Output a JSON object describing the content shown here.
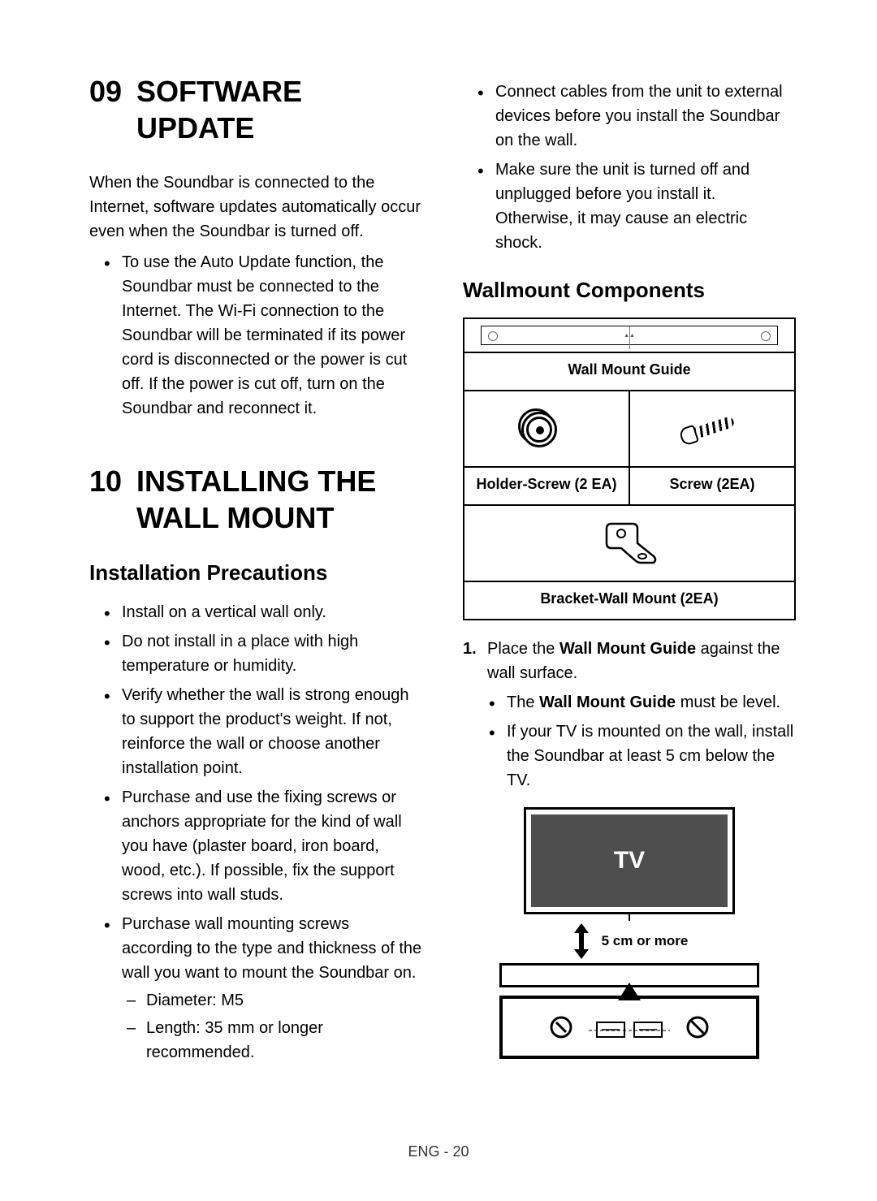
{
  "section09": {
    "number": "09",
    "title": "SOFTWARE UPDATE",
    "intro": "When the Soundbar is connected to the Internet, software updates automatically occur even when the Soundbar is turned off.",
    "bullets": [
      "To use the Auto Update function, the Soundbar must be connected to the Internet. The Wi-Fi connection to the Soundbar will be terminated if its power cord is disconnected or the power is cut off. If the power is cut off, turn on the Soundbar and reconnect it."
    ]
  },
  "section10": {
    "number": "10",
    "title": "INSTALLING THE WALL MOUNT",
    "precautions_heading": "Installation Precautions",
    "precautions": [
      {
        "text": "Install on a vertical wall only."
      },
      {
        "text": "Do not install in a place with high temperature or humidity."
      },
      {
        "text": "Verify whether the wall is strong enough to support the product's weight. If not, reinforce the wall or choose another installation point."
      },
      {
        "text": "Purchase and use the fixing screws or anchors appropriate for the kind of wall you have (plaster board, iron board, wood, etc.). If possible, fix the support screws into wall studs."
      },
      {
        "text": "Purchase wall mounting screws according to the type and thickness of the wall you want to mount the Soundbar on.",
        "sub": [
          "Diameter: M5",
          "Length: 35 mm or longer recommended."
        ]
      },
      {
        "text": "Connect cables from the unit to external devices before you install the Soundbar on the wall."
      },
      {
        "text": "Make sure the unit is turned off and unplugged before you install it. Otherwise, it may cause an electric shock."
      }
    ],
    "components_heading": "Wallmount Components",
    "components": {
      "guide_label": "Wall Mount Guide",
      "holder_screw_label": "Holder-Screw (2 EA)",
      "screw_label": "Screw (2EA)",
      "bracket_label": "Bracket-Wall Mount (2EA)"
    },
    "step1": {
      "num": "1.",
      "text_before": "Place the ",
      "bold": "Wall Mount Guide",
      "text_after": " against the wall surface.",
      "sub": [
        {
          "before": "The ",
          "bold": "Wall Mount Guide",
          "after": " must be level."
        },
        {
          "before": "If your TV is mounted on the wall, install the Soundbar at least 5 cm below the TV.",
          "bold": "",
          "after": ""
        }
      ]
    },
    "diagram": {
      "tv_label": "TV",
      "distance_label": "5 cm or more"
    }
  },
  "footer": "ENG - 20"
}
